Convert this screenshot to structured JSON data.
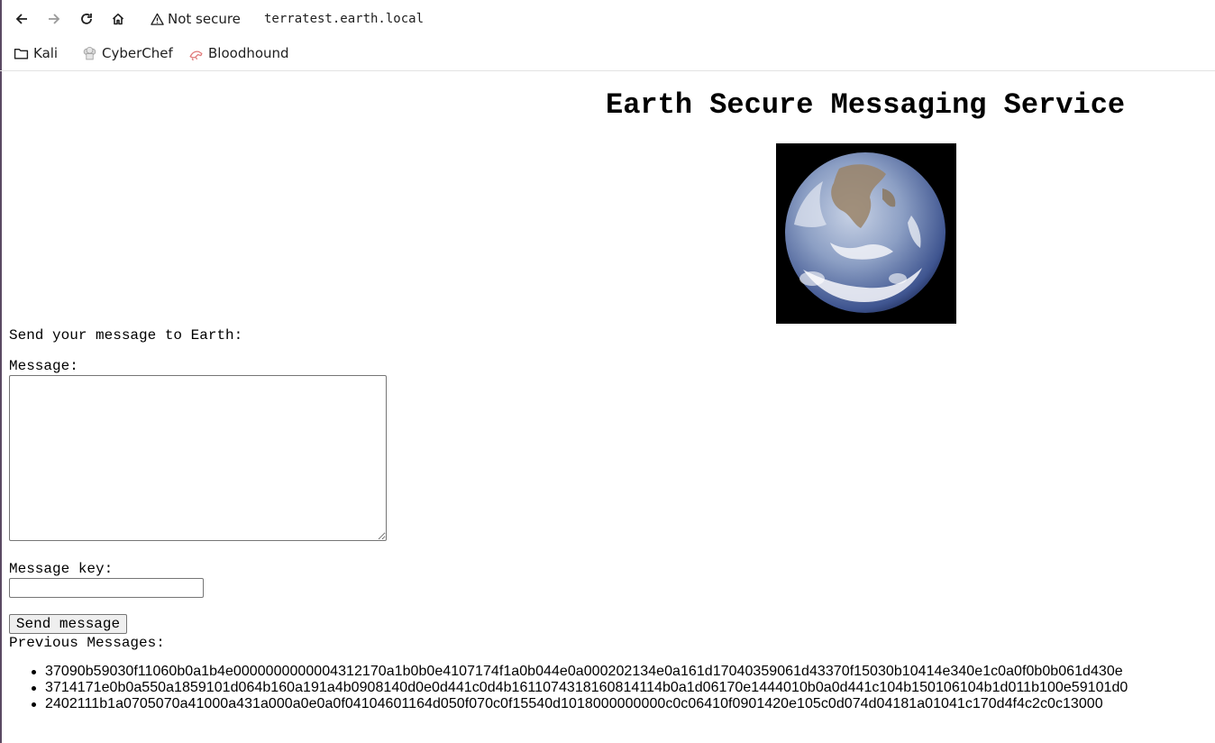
{
  "browser": {
    "security_label": "Not secure",
    "url": "terratest.earth.local",
    "toolbar_icons": [
      "back-icon",
      "forward-icon",
      "reload-icon",
      "home-icon",
      "warning-icon"
    ]
  },
  "bookmarks": [
    {
      "label": "Kali",
      "icon": "folder-icon"
    },
    {
      "label": "CyberChef",
      "icon": "chef-hat-icon"
    },
    {
      "label": "Bloodhound",
      "icon": "bloodhound-icon"
    }
  ],
  "page": {
    "title": "Earth Secure Messaging Service",
    "image": "earth-photo",
    "send_prompt": "Send your message to Earth:",
    "message_label": "Message:",
    "message_value": "",
    "key_label": "Message key:",
    "key_value": "",
    "send_button": "Send message",
    "previous_label": "Previous Messages:",
    "messages": [
      "37090b59030f11060b0a1b4e0000000000004312170a1b0b0e4107174f1a0b044e0a000202134e0a161d17040359061d43370f15030b10414e340e1c0a0f0b0b061d430e",
      "3714171e0b0a550a1859101d064b160a191a4b0908140d0e0d441c0d4b1611074318160814114b0a1d06170e1444010b0a0d441c104b150106104b1d011b100e59101d0",
      "2402111b1a0705070a41000a431a000a0e0a0f04104601164d050f070c0f15540d1018000000000c0c06410f0901420e105c0d074d04181a01041c170d4f4c2c0c13000"
    ]
  },
  "colors": {
    "text": "#000000",
    "chrome_text": "#1f1f1f",
    "button_bg": "#efefef",
    "border": "#767676"
  }
}
